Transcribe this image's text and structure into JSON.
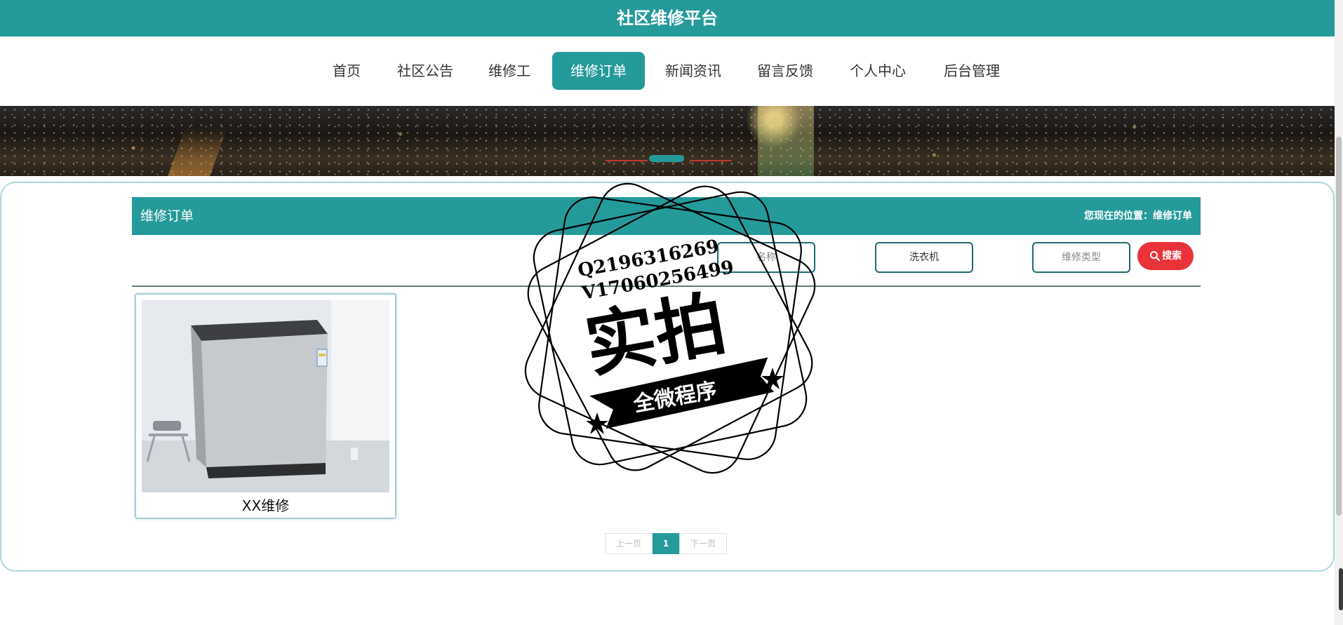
{
  "header": {
    "title": "社区维修平台"
  },
  "nav": {
    "items": [
      {
        "label": "首页"
      },
      {
        "label": "社区公告"
      },
      {
        "label": "维修工"
      },
      {
        "label": "维修订单"
      },
      {
        "label": "新闻资讯"
      },
      {
        "label": "留言反馈"
      },
      {
        "label": "个人中心"
      },
      {
        "label": "后台管理"
      }
    ],
    "active_label": "维修订单"
  },
  "section": {
    "title": "维修订单",
    "breadcrumb": "您现在的位置：维修订单"
  },
  "search": {
    "name_placeholder": "名称",
    "category_value": "洗衣机",
    "type_placeholder": "维修类型",
    "button_label": "搜索"
  },
  "products": [
    {
      "name": "XX维修"
    }
  ],
  "pagination": {
    "prev_label": "上一页",
    "current_page": "1",
    "next_label": "下一页"
  },
  "watermark": {
    "line1": "Q2196316269",
    "line2": "V17060256499",
    "main": "实拍",
    "ribbon": "全微程序"
  },
  "colors": {
    "primary": "#259a9a",
    "search_button": "#e8333a",
    "border": "#1d6b73"
  }
}
